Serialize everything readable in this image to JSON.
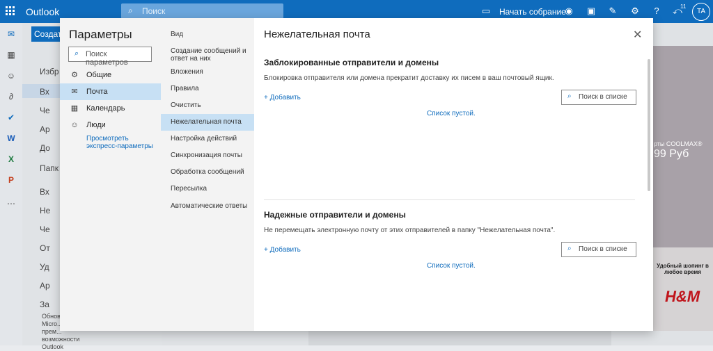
{
  "app": {
    "brand": "Outlook",
    "search_placeholder": "Поиск",
    "meet_label": "Начать собрание",
    "notifications_count": "11",
    "avatar_initials": "TA"
  },
  "background": {
    "new_message": "Создать",
    "folder_labels": [
      "Избр",
      "Вх",
      "Че",
      "Ар",
      "До",
      "Папк",
      "Вх",
      "Не",
      "Че",
      "От",
      "Уд",
      "Ар",
      "За"
    ],
    "upgrade_text": "Обнов... Micro... прем... возможности Outlook",
    "ad_text_1": "рты COOLMAX®",
    "ad_text_2": "99 Руб",
    "ad_promo": "Удобный шопинг в любое время",
    "ad_brand": "H&M"
  },
  "modal": {
    "title": "Параметры",
    "search_placeholder": "Поиск параметров",
    "categories": [
      {
        "label": "Общие",
        "icon": "gear-icon"
      },
      {
        "label": "Почта",
        "icon": "mail-icon"
      },
      {
        "label": "Календарь",
        "icon": "calendar-icon"
      },
      {
        "label": "Люди",
        "icon": "people-icon"
      }
    ],
    "express_link": "Просмотреть экспресс-параметры",
    "subcategories": [
      "Вид",
      "Создание сообщений и ответ на них",
      "Вложения",
      "Правила",
      "Очистить",
      "Нежелательная почта",
      "Настройка действий",
      "Синхронизация почты",
      "Обработка сообщений",
      "Пересылка",
      "Автоматические ответы"
    ],
    "active_subcategory": "Нежелательная почта",
    "page_title": "Нежелательная почта",
    "blocked": {
      "heading": "Заблокированные отправители и домены",
      "description": "Блокировка отправителя или домена прекратит доставку их писем в ваш почтовый ящик.",
      "add_label": "Добавить",
      "search_label": "Поиск в списке",
      "empty_label": "Список пустой."
    },
    "safe": {
      "heading": "Надежные отправители и домены",
      "description": "Не перемещать электронную почту от этих отправителей в папку \"Нежелательная почта\".",
      "add_label": "Добавить",
      "search_label": "Поиск в списке",
      "empty_label": "Список пустой."
    }
  },
  "colors": {
    "brand": "#0f6cbd",
    "selected": "#c7e0f4"
  }
}
